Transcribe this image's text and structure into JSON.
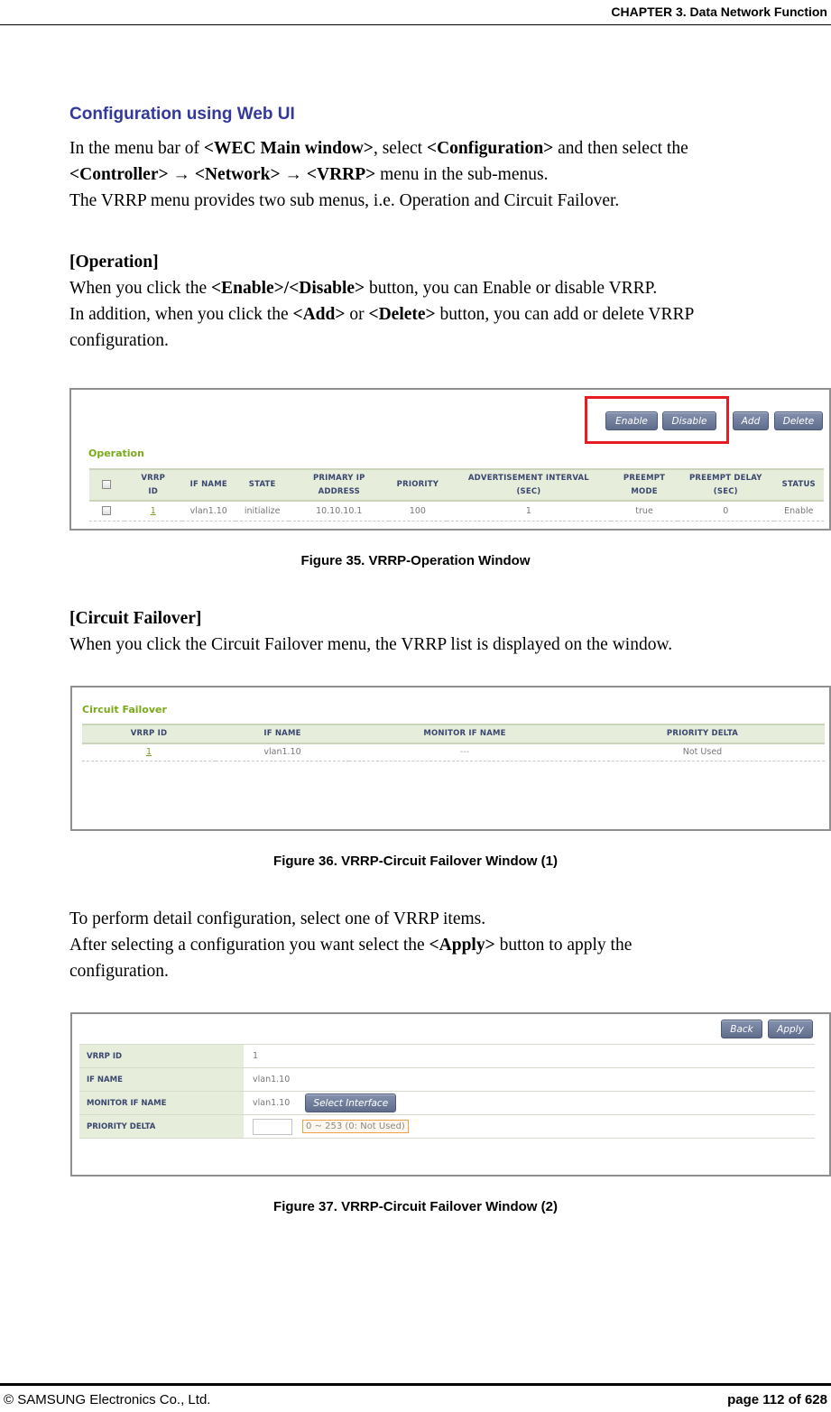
{
  "header": {
    "chapter": "CHAPTER 3. Data Network Function"
  },
  "section_title": "Configuration using Web UI",
  "intro": {
    "l1_a": "In the menu bar of ",
    "l1_b": "<WEC Main window>",
    "l1_c": ", select ",
    "l1_d": "<Configuration>",
    "l1_e": " and then select the",
    "l2_a": "<Controller> → <Network> → <VRRP>",
    "l2_b": " menu in the sub-menus.",
    "l3": "The VRRP menu provides two sub menus, i.e. Operation and Circuit Failover."
  },
  "operation": {
    "heading": "[Operation]",
    "l1_a": "When you click the ",
    "l1_b": "<Enable>/<Disable>",
    "l1_c": " button, you can Enable or disable VRRP.",
    "l2_a": "In addition, when you click the ",
    "l2_b": "<Add>",
    "l2_c": " or ",
    "l2_d": "<Delete>",
    "l2_e": " button, you can add or delete VRRP",
    "l3": "configuration."
  },
  "fig35": {
    "ui_title": "Operation",
    "buttons": {
      "enable": "Enable",
      "disable": "Disable",
      "add": "Add",
      "delete": "Delete"
    },
    "highlight_color": "#e51c23",
    "columns": [
      "VRRP ID",
      "IF NAME",
      "STATE",
      "PRIMARY IP ADDRESS",
      "PRIORITY",
      "ADVERTISEMENT INTERVAL (SEC)",
      "PREEMPT MODE",
      "PREEMPT DELAY (SEC)",
      "STATUS"
    ],
    "col_l1": [
      "VRRP",
      "IF NAME",
      "STATE",
      "PRIMARY IP",
      "PRIORITY",
      "ADVERTISEMENT INTERVAL",
      "PREEMPT",
      "PREEMPT DELAY",
      "STATUS"
    ],
    "col_l2": [
      "ID",
      "",
      "",
      "ADDRESS",
      "",
      "(SEC)",
      "MODE",
      "(SEC)",
      ""
    ],
    "rows": [
      {
        "vrrp_id": "1",
        "if_name": "vlan1.10",
        "state": "initialize",
        "primary_ip": "10.10.10.1",
        "priority": "100",
        "adv_interval": "1",
        "preempt_mode": "true",
        "preempt_delay": "0",
        "status": "Enable"
      }
    ],
    "caption": "Figure 35. VRRP-Operation Window"
  },
  "circuit": {
    "heading": "[Circuit Failover]",
    "l1": "When you click the Circuit Failover menu, the VRRP list is displayed on the window."
  },
  "fig36": {
    "ui_title": "Circuit Failover",
    "columns": [
      "VRRP ID",
      "IF NAME",
      "MONITOR IF NAME",
      "PRIORITY DELTA"
    ],
    "rows": [
      {
        "vrrp_id": "1",
        "if_name": "vlan1.10",
        "monitor_if_name": "---",
        "priority_delta": "Not Used"
      }
    ],
    "caption": "Figure 36. VRRP-Circuit Failover Window (1)"
  },
  "detail_text": {
    "l1": "To perform detail configuration, select one of VRRP items.",
    "l2_a": "After selecting a configuration you want select the ",
    "l2_b": "<Apply>",
    "l2_c": " button to apply the",
    "l3": "configuration."
  },
  "fig37": {
    "buttons": {
      "back": "Back",
      "apply": "Apply",
      "select_interface": "Select Interface"
    },
    "fields": [
      {
        "label": "VRRP ID",
        "value": "1"
      },
      {
        "label": "IF NAME",
        "value": "vlan1.10"
      },
      {
        "label": "MONITOR IF NAME",
        "value": "vlan1.10"
      },
      {
        "label": "PRIORITY DELTA",
        "value": ""
      }
    ],
    "priority_delta_hint": "0 ~ 253 (0: Not Used)",
    "caption": "Figure 37. VRRP-Circuit Failover Window (2)"
  },
  "footer": {
    "copyright": "© SAMSUNG Electronics Co., Ltd.",
    "page": "page 112 of 628"
  }
}
